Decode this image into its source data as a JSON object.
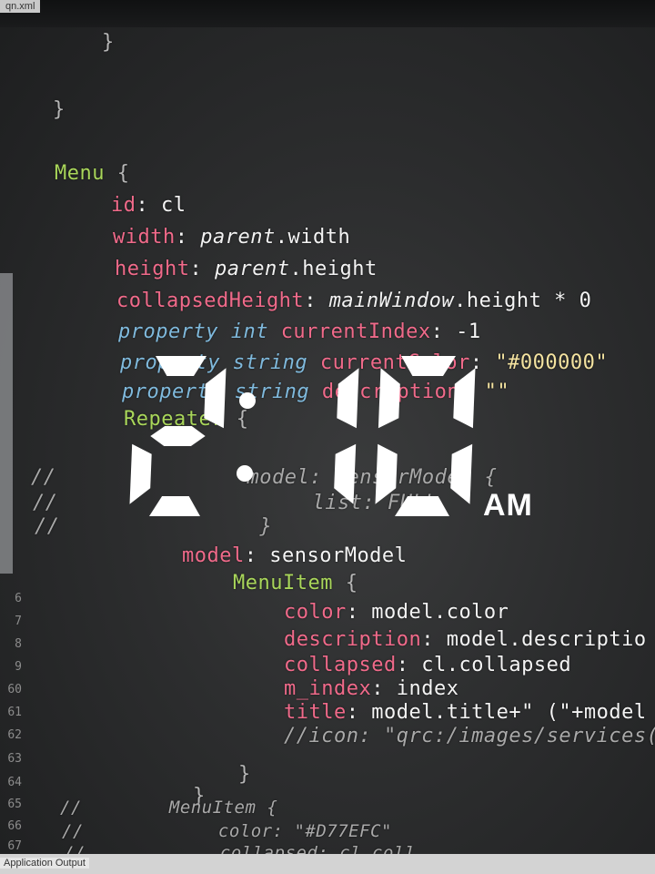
{
  "window": {
    "file_tab": "qn.xml",
    "bottom_tab": "Application Output"
  },
  "clock": {
    "time": "2:10",
    "hour": "2",
    "minutes": "10",
    "ampm": "AM",
    "color": "#ffffff"
  },
  "colors": {
    "background": "#2c2d2e",
    "property_key": "#f06a8a",
    "keyword": "#7fb9dc",
    "type_name": "#a9d65a",
    "string": "#f4e3a0",
    "comment": "#a9a9a9"
  },
  "code": {
    "brace1": "}",
    "brace2": "}",
    "menu_type": "Menu",
    "menu_open": " {",
    "id_key": "id",
    "id_val": ": cl",
    "width_key": "width",
    "width_val_obj": "parent",
    "width_val_rest": ".width",
    "height_key": "height",
    "height_val_obj": "parent",
    "height_val_rest": ".height",
    "collapsed_key": "collapsedHeight",
    "collapsed_val_obj": "mainWindow",
    "collapsed_val_rest": ".height * 0",
    "prop1_kw": "property int ",
    "prop1_name": "currentIndex",
    "prop1_val": ": -1",
    "prop2_kw": "property string ",
    "prop2_name": "currentColor",
    "prop2_val_sep": ": ",
    "prop2_val": "\"#000000\"",
    "prop3_kw": "property string ",
    "prop3_name": "description",
    "prop3_val_sep": ": ",
    "prop3_val": "\"\"",
    "repeater": "Repeater",
    "repeater_open": " {",
    "cmt1": "//",
    "cmt1_code": "model: SensorModel {",
    "cmt2": "//",
    "cmt2_code": "list: FULL",
    "cmt3": "//",
    "cmt3_code": "}",
    "model_key": "model",
    "model_val": ": sensorModel",
    "menuitem_type": "MenuItem",
    "menuitem_open": " {",
    "color_key": "color",
    "color_val": ": model.color",
    "desc_key": "description",
    "desc_val": ": model.descriptio",
    "coll_key": "collapsed",
    "coll_val": ": cl.collapsed",
    "mindex_key": "m_index",
    "mindex_val": ": index",
    "title_key": "title",
    "title_val": ": model.title+\" (\"+model",
    "icon_comment": "//icon: \"qrc:/images/services(",
    "close_brace_inner": "}",
    "close_brace_outer": "}",
    "cmt4": "//",
    "cmt4_code": "MenuItem {",
    "cmt5": "//",
    "cmt5_code": "color: \"#D77EFC\"",
    "cmt6": "//",
    "cmt6_code": "collapsed: cl.coll"
  },
  "line_numbers": [
    "6",
    "7",
    "8",
    "9",
    "60",
    "61",
    "62",
    "63",
    "64",
    "65",
    "66",
    "67"
  ]
}
